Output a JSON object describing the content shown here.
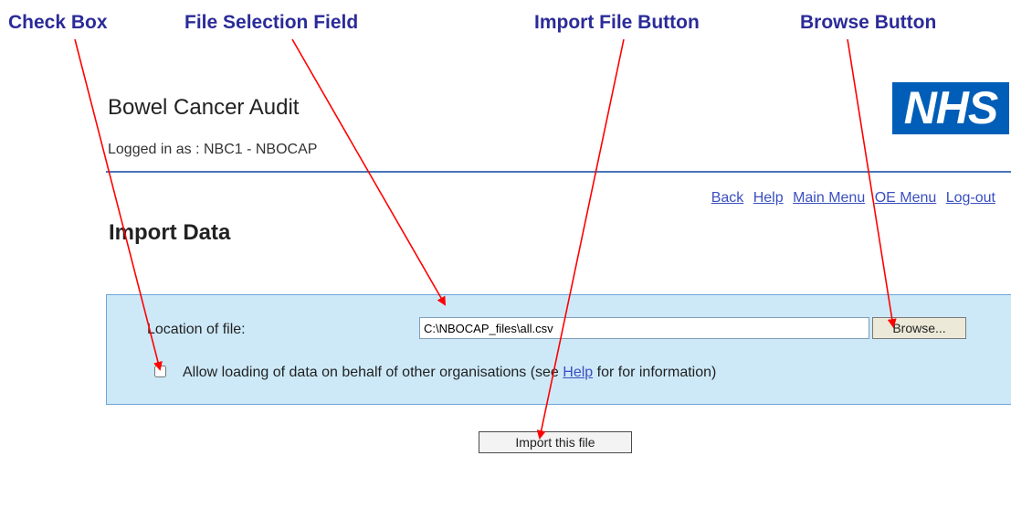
{
  "callouts": {
    "check_box": "Check Box",
    "file_selection_field": "File Selection Field",
    "import_file_button": "Import File Button",
    "browse_button": "Browse Button",
    "color": "#2b2b99",
    "arrow_color": "#ff0000"
  },
  "header": {
    "app_title": "Bowel Cancer Audit",
    "logged_in_label": "Logged in as : ",
    "logged_in_user": "NBC1 - NBOCAP",
    "logo_text": "NHS",
    "logo_color": "#005eb8"
  },
  "nav": {
    "items": [
      "Back",
      "Help",
      "Main Menu",
      "OE Menu",
      "Log-out"
    ]
  },
  "page": {
    "title": "Import Data"
  },
  "form": {
    "location_label": "Location of file:",
    "file_value": "C:\\NBOCAP_files\\all.csv",
    "browse_label": "Browse...",
    "checkbox_checked": false,
    "allow_text_before": "Allow loading of data on behalf of other organisations (see ",
    "allow_link": "Help",
    "allow_text_after": " for for information)",
    "import_label": "Import this file",
    "panel_color": "#cde9f8"
  }
}
